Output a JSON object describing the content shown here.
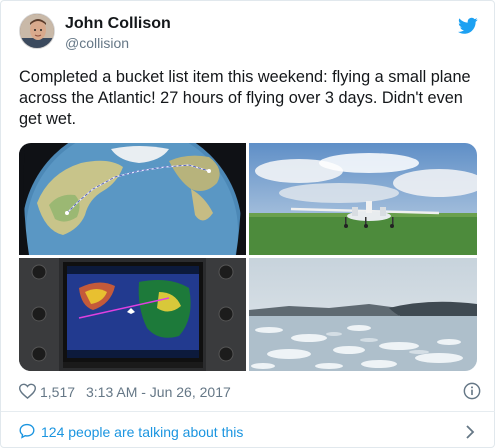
{
  "author": {
    "name": "John Collison",
    "handle": "@collision"
  },
  "tweet": {
    "text": "Completed a bucket list item this weekend: flying a small plane across the Atlantic! 27 hours of flying over 3 days. Didn't even get wet."
  },
  "media": {
    "count": 4,
    "images": [
      "globe-map-flight-route",
      "small-plane-on-grass",
      "cockpit-navigation-display",
      "ice-filled-fjord"
    ]
  },
  "meta": {
    "likes": "1,517",
    "timestamp": "3:13 AM - Jun 26, 2017"
  },
  "footer": {
    "talking": "124 people are talking about this"
  },
  "colors": {
    "twitter_blue": "#1da1f2",
    "link_blue": "#1b95e0",
    "secondary_text": "#657786",
    "border": "#e1e8ed"
  },
  "icons": [
    "twitter-bird-icon",
    "heart-icon",
    "info-icon",
    "speech-bubble-icon",
    "chevron-right-icon"
  ]
}
